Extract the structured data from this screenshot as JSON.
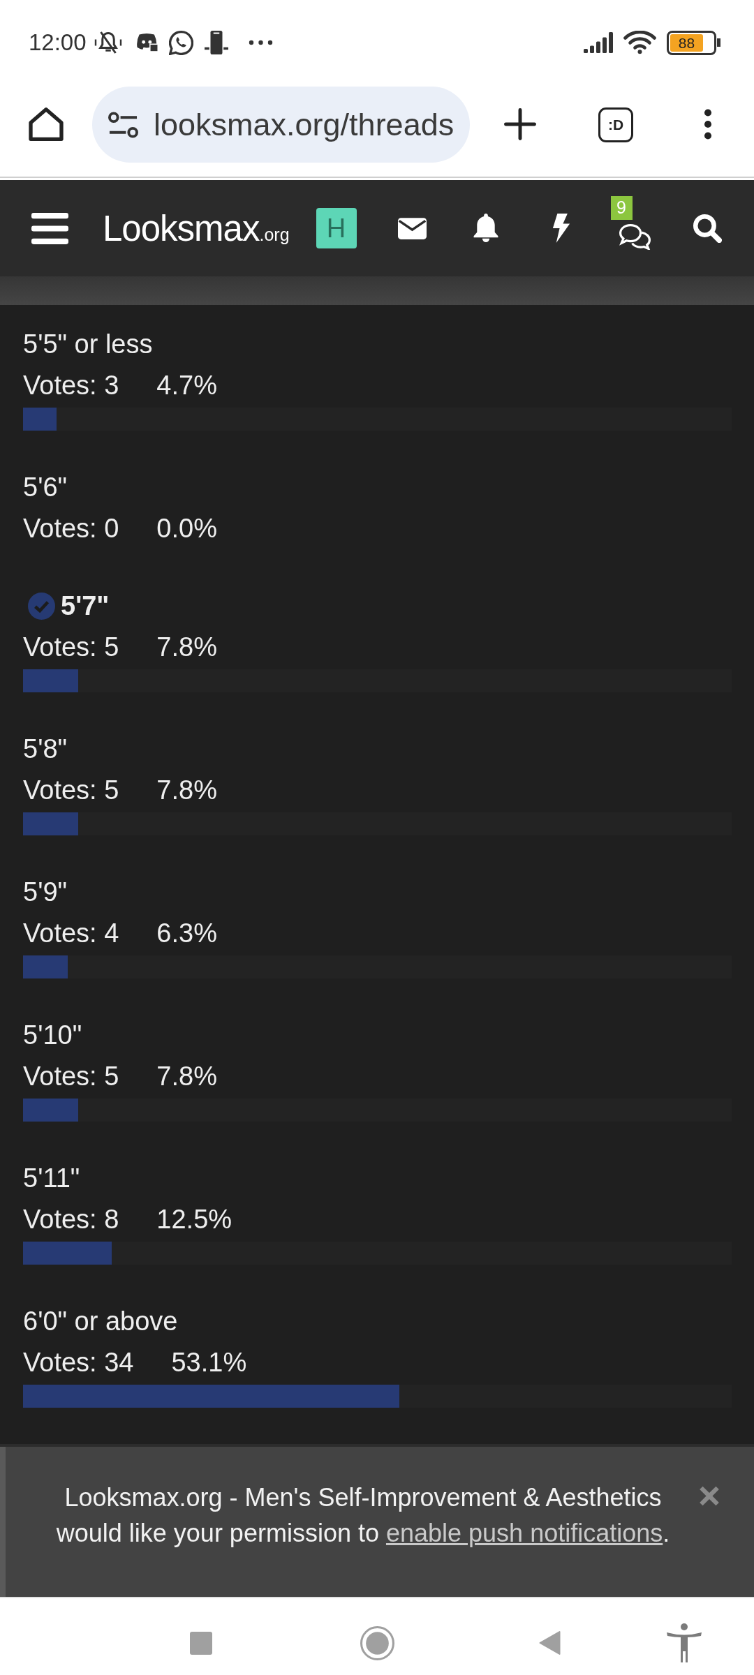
{
  "status_bar": {
    "time": "12:00",
    "battery": "88"
  },
  "browser": {
    "url": "looksmax.org/threads",
    "tab_switcher": ":D"
  },
  "site_header": {
    "logo": "Looksmax",
    "logo_suffix": ".org",
    "avatar_letter": "H",
    "conversations_badge": "9"
  },
  "poll": {
    "options": [
      {
        "label": "5'5\" or less",
        "votes": "Votes: 3",
        "percent": "4.7%",
        "level": 0.047,
        "selected": false
      },
      {
        "label": "5'6\"",
        "votes": "Votes: 0",
        "percent": "0.0%",
        "selected": false
      },
      {
        "label": "5'7\"",
        "votes": "Votes: 5",
        "percent": "7.8%",
        "level": 0.078,
        "selected": true
      },
      {
        "label": "5'8\"",
        "votes": "Votes: 5",
        "percent": "7.8%",
        "level": 0.078,
        "selected": false
      },
      {
        "label": "5'9\"",
        "votes": "Votes: 4",
        "percent": "6.3%",
        "level": 0.063,
        "selected": false
      },
      {
        "label": "5'10\"",
        "votes": "Votes: 5",
        "percent": "7.8%",
        "level": 0.078,
        "selected": false
      },
      {
        "label": "5'11\"",
        "votes": "Votes: 8",
        "percent": "12.5%",
        "level": 0.125,
        "selected": false
      },
      {
        "label": "6'0\" or above",
        "votes": "Votes: 34",
        "percent": "53.1%",
        "level": 0.531,
        "selected": false
      }
    ]
  },
  "notification_banner": {
    "message": "Looksmax.org - Men's Self-Improvement & Aesthetics would like your permission to ",
    "link": "enable push notifications",
    "message_end": "."
  }
}
